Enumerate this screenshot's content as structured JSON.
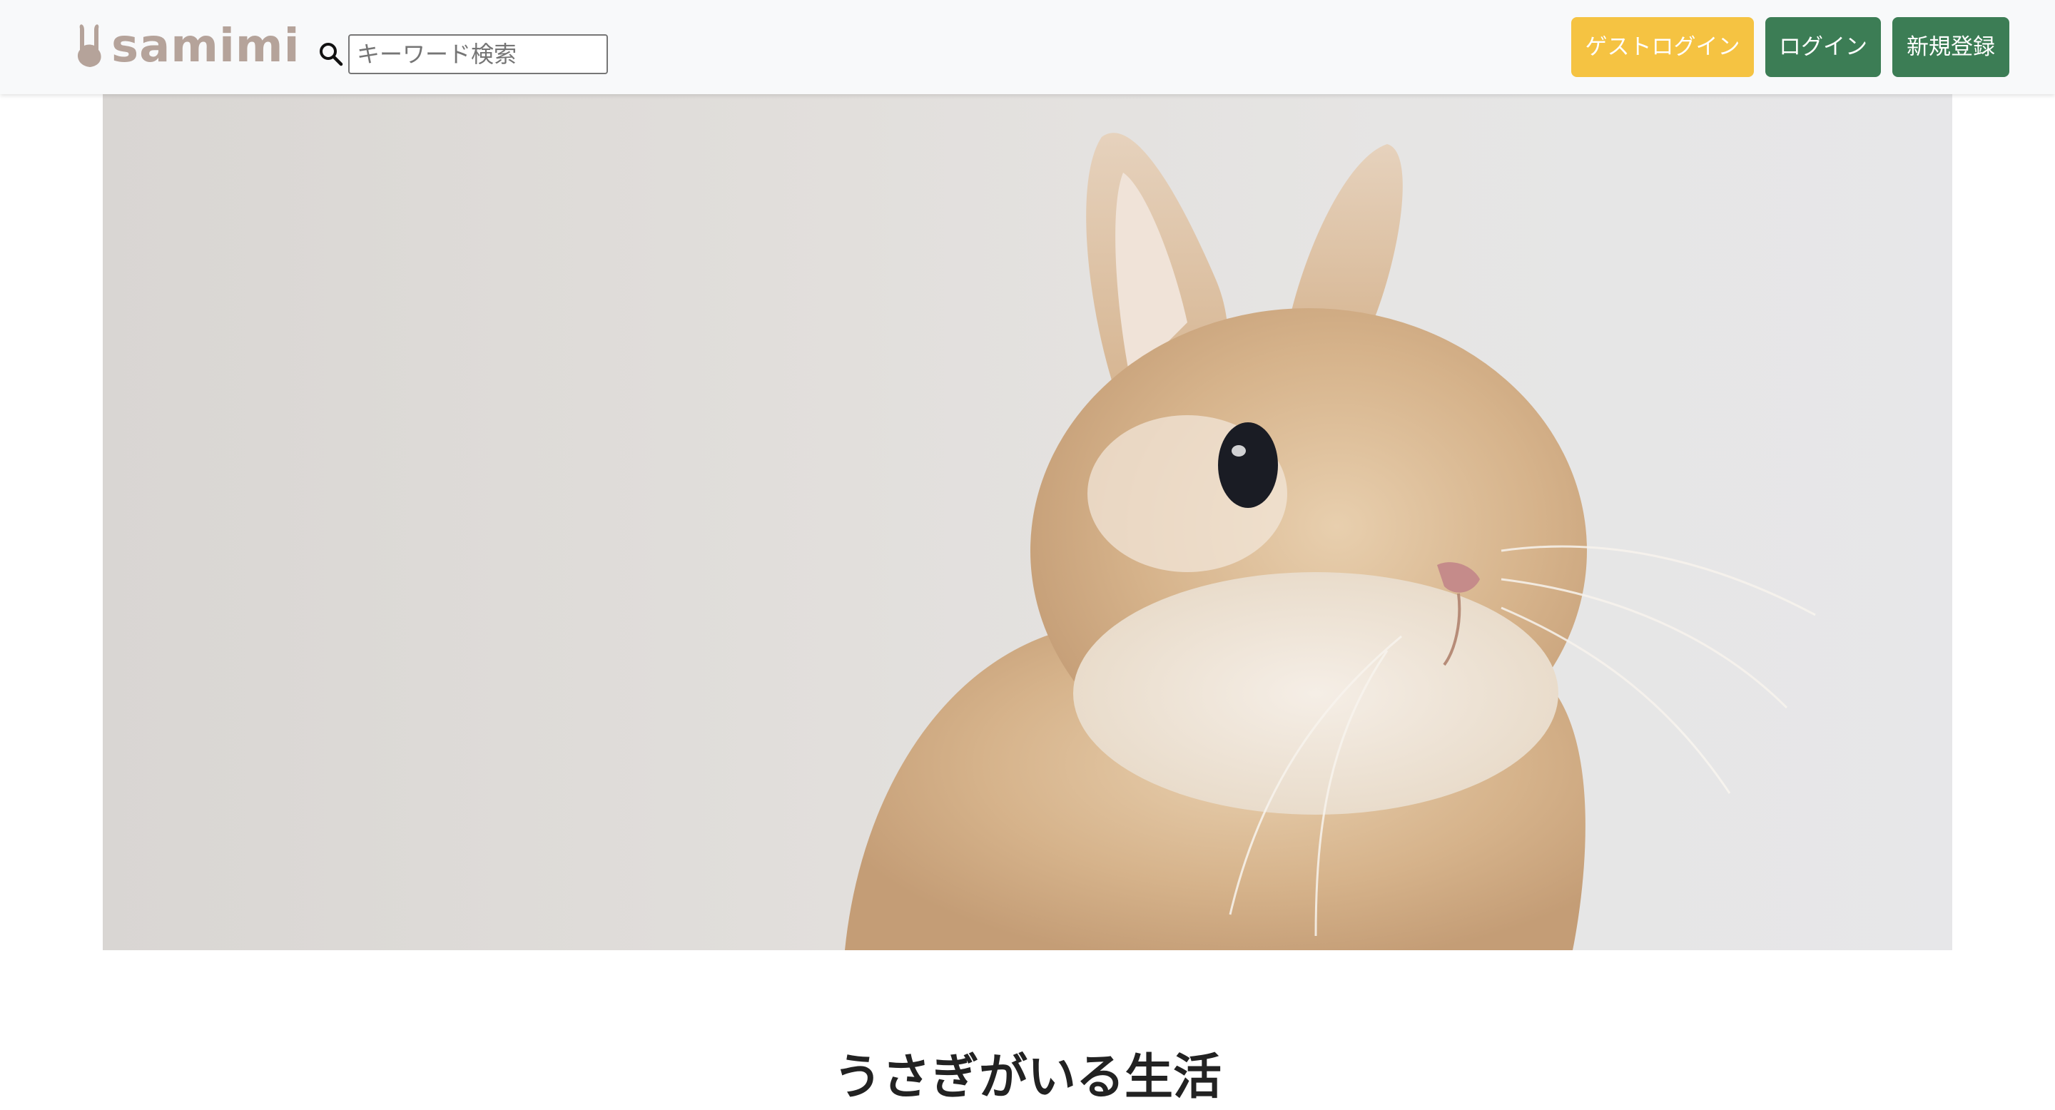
{
  "header": {
    "logo_text": "samimi",
    "search": {
      "placeholder": "キーワード検索",
      "value": ""
    },
    "buttons": {
      "guest_login": "ゲストログイン",
      "login": "ログイン",
      "signup": "新規登録"
    }
  },
  "main": {
    "title": "うさぎがいる生活"
  },
  "colors": {
    "navbar_bg": "#f8f9fa",
    "guest_button": "#f5c342",
    "primary_button": "#3c7d55",
    "logo": "#b5a39a"
  },
  "icons": [
    "rabbit-logo-icon",
    "search-icon"
  ]
}
